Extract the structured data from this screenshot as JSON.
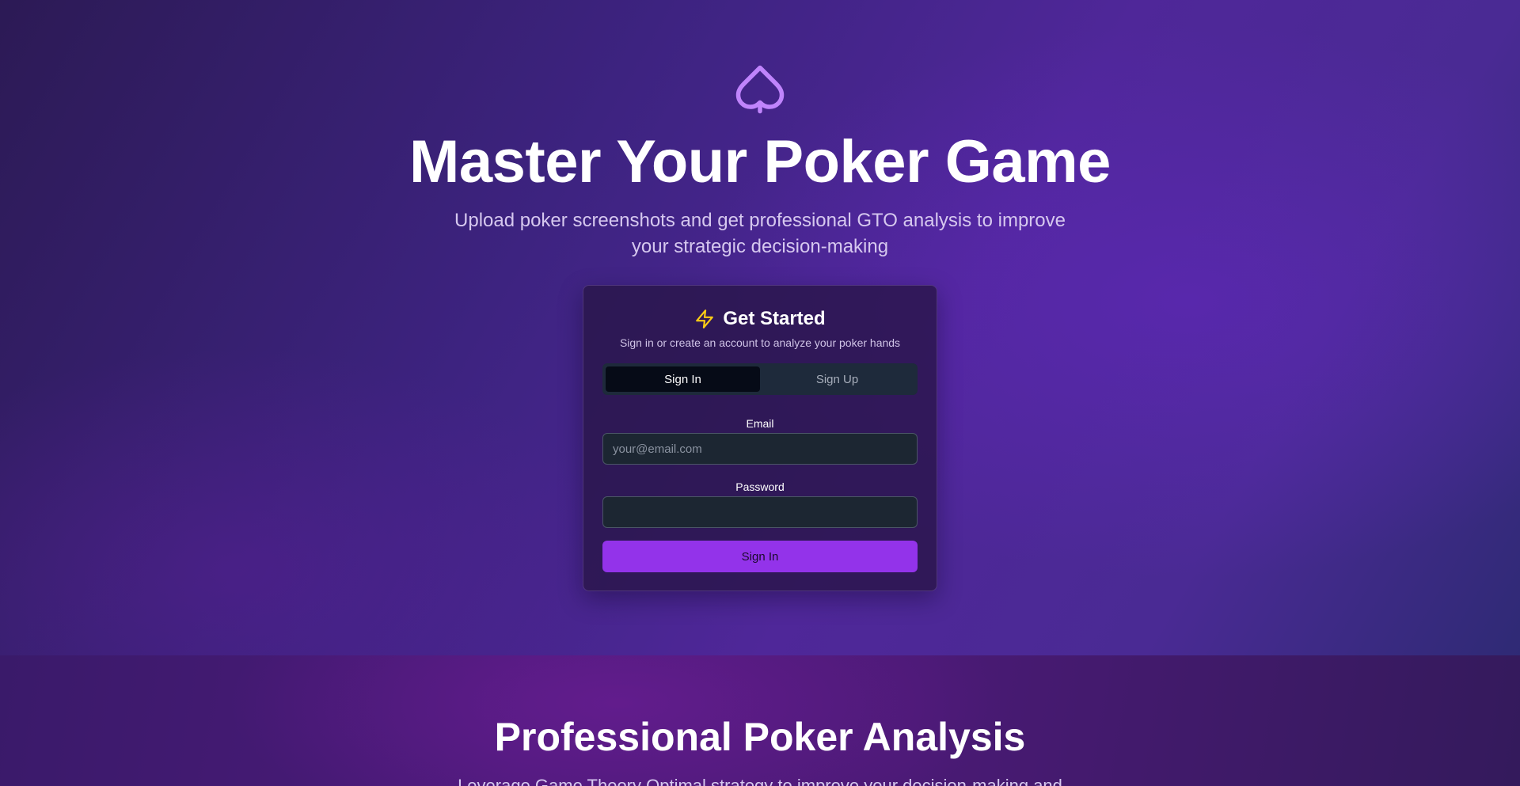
{
  "hero": {
    "icon": "spade-icon",
    "title": "Master Your Poker Game",
    "subtitle": "Upload poker screenshots and get professional GTO analysis to improve your strategic decision-making"
  },
  "auth_card": {
    "icon": "lightning-bolt-icon",
    "title": "Get Started",
    "description": "Sign in or create an account to analyze your poker hands",
    "tabs": [
      {
        "label": "Sign In",
        "active": true
      },
      {
        "label": "Sign Up",
        "active": false
      }
    ],
    "email": {
      "label": "Email",
      "placeholder": "your@email.com",
      "value": ""
    },
    "password": {
      "label": "Password",
      "value": ""
    },
    "submit_label": "Sign In"
  },
  "features": {
    "title": "Professional Poker Analysis",
    "subtitle": "Leverage Game Theory Optimal strategy to improve your decision-making and"
  },
  "colors": {
    "accent": "#9333ea",
    "spade_icon": "#c084fc",
    "bolt_icon": "#facc15",
    "tab_active_bg": "#060b17",
    "tab_bar_bg": "#1e2a3b",
    "input_bg": "#1c2632"
  }
}
